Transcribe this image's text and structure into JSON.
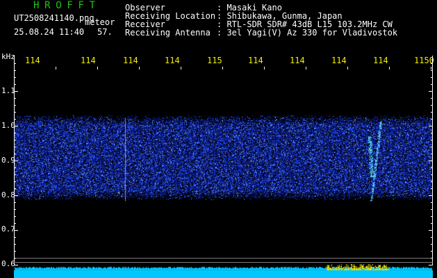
{
  "header": {
    "app_name": "HROFFT",
    "filename": "UT2508241140.png",
    "mode": "meteor",
    "datetime": "25.08.24 11:40",
    "count": "57.",
    "observer_label": "Observer",
    "observer_value": ": Masaki Kano",
    "location_label": "Receiving Location",
    "location_value": ": Shibukawa, Gunma, Japan",
    "receiver_label": "Receiver",
    "receiver_value": ": RTL-SDR SDR# 43dB L15 103.2MHz CW",
    "antenna_label": "Receiving Antenna",
    "antenna_value": ": 3el Yagi(V) Az 330 for Vladivostok"
  },
  "x_axis": {
    "labels": [
      "114",
      "114",
      "114",
      "114",
      "115",
      "114",
      "114",
      "114",
      "114",
      "1150"
    ]
  },
  "y_axis": {
    "unit": "kHz",
    "labels": [
      "1.1",
      "1.0",
      "0.9",
      "0.8",
      "0.7",
      "0.6"
    ]
  },
  "colors": {
    "background": "#000000",
    "header_text": "#ffffff",
    "app_name": "#19c819",
    "time_labels": "#f0f000",
    "signal": "#1e46ff",
    "bottom_strip": "#00c8ff"
  }
}
